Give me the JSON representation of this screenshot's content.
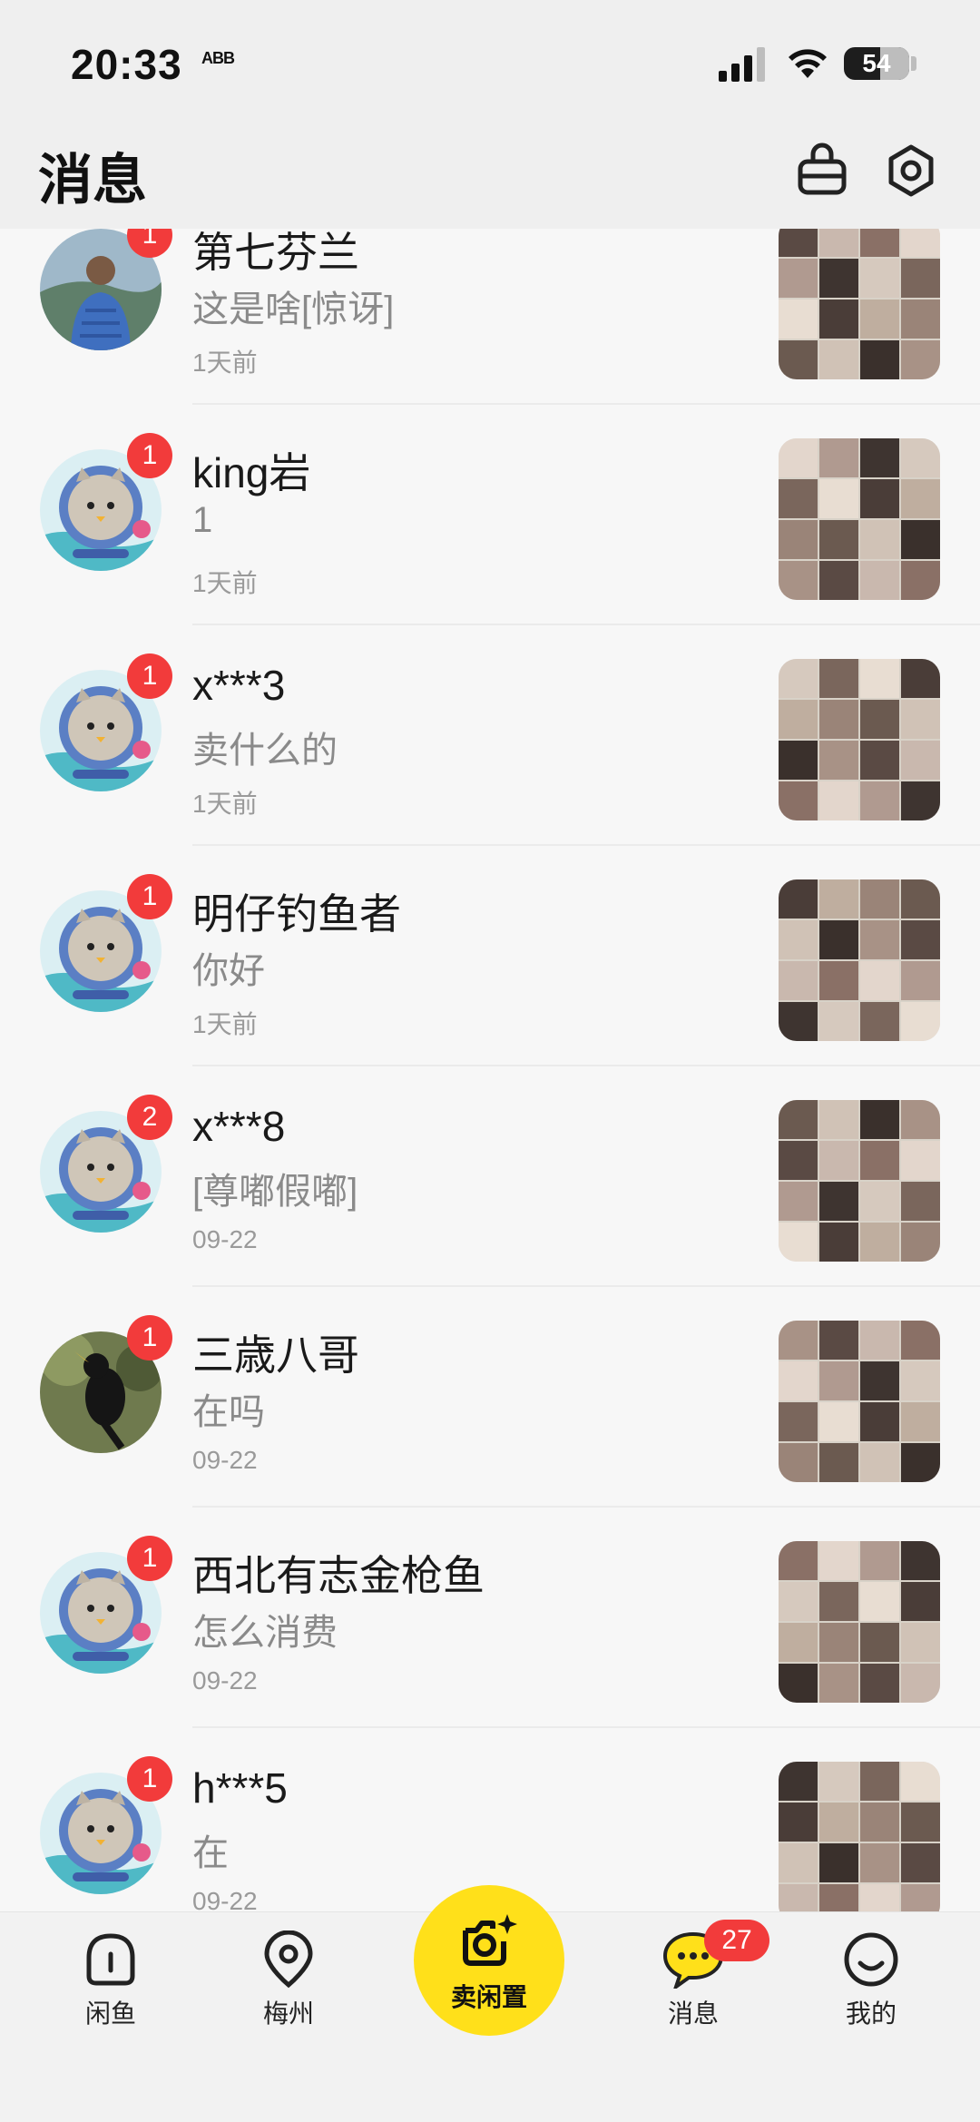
{
  "status_bar": {
    "time": "20:33",
    "tiny_label": "ABB",
    "battery": "54"
  },
  "header": {
    "title": "消息",
    "icons": [
      "bag-icon",
      "settings-icon"
    ]
  },
  "conversations": [
    {
      "name": "第七芬兰",
      "message": "这是啥[惊讶]",
      "date": "1天前",
      "badge": "1",
      "avatar": "photo-man"
    },
    {
      "name": "king岩",
      "message": "1",
      "date": "1天前",
      "badge": "1",
      "avatar": "default-cat"
    },
    {
      "name": "x***3",
      "message": "卖什么的",
      "date": "1天前",
      "badge": "1",
      "avatar": "default-cat"
    },
    {
      "name": "明仔钓鱼者",
      "message": "你好",
      "date": "1天前",
      "badge": "1",
      "avatar": "default-cat"
    },
    {
      "name": "x***8",
      "message": "[尊嘟假嘟]",
      "date": "09-22",
      "badge": "2",
      "avatar": "default-cat"
    },
    {
      "name": "三歳八哥",
      "message": "在吗",
      "date": "09-22",
      "badge": "1",
      "avatar": "photo-bird"
    },
    {
      "name": "西北有志金枪鱼",
      "message": "怎么消费",
      "date": "09-22",
      "badge": "1",
      "avatar": "default-cat"
    },
    {
      "name": "h***5",
      "message": "在",
      "date": "09-22",
      "badge": "1",
      "avatar": "default-cat"
    }
  ],
  "tabbar": {
    "home": "闲鱼",
    "location": "梅州",
    "sell": "卖闲置",
    "messages": "消息",
    "messages_badge": "27",
    "me": "我的"
  },
  "colors": {
    "accent": "#ffe01a",
    "badge": "#f23b3b"
  }
}
